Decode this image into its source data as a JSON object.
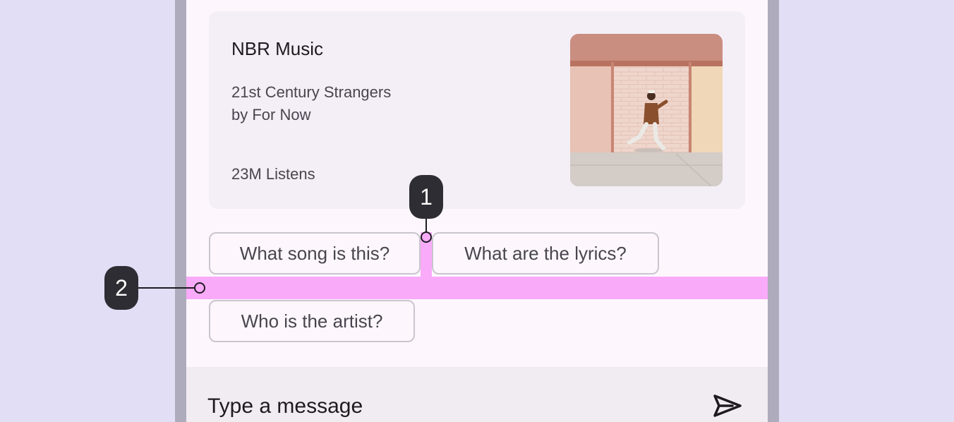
{
  "card": {
    "title": "NBR Music",
    "song_title": "21st Century Strangers",
    "song_artist": "by For Now",
    "listens": "23M Listens",
    "image_icon": "album-art-photo"
  },
  "suggestions": [
    {
      "label": "What song is this?"
    },
    {
      "label": "What are the lyrics?"
    },
    {
      "label": "Who is the artist?"
    }
  ],
  "composer": {
    "placeholder": "Type a message",
    "send_icon": "send-icon"
  },
  "annotations": [
    {
      "number": "1"
    },
    {
      "number": "2"
    }
  ],
  "colors": {
    "background": "#e1def6",
    "frame": "#adabbc",
    "screen": "#fdf7fd",
    "card": "#f4eff6",
    "spacing_highlight": "#f9abf9",
    "badge": "#2e2d33"
  }
}
